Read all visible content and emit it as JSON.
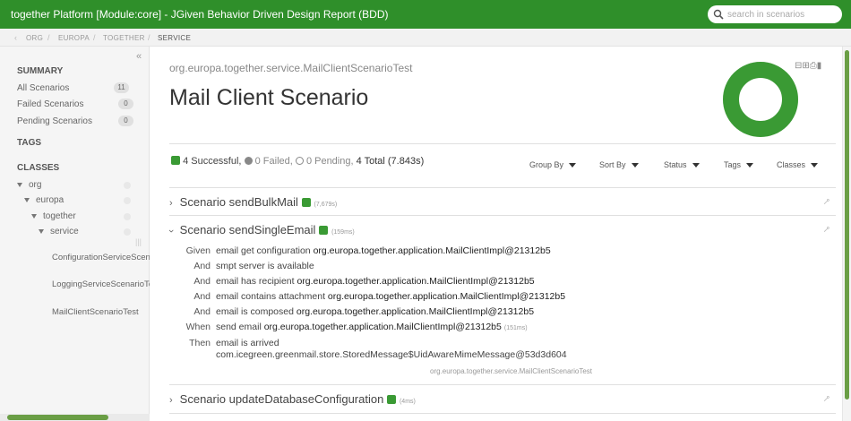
{
  "app": {
    "title": "together Platform [Module:core] - JGiven Behavior Driven Design Report (BDD)"
  },
  "search": {
    "placeholder": "search in scenarios"
  },
  "breadcrumb": [
    "ORG",
    "EUROPA",
    "TOGETHER",
    "SERVICE"
  ],
  "sidebar": {
    "summary_heading": "SUMMARY",
    "summary_items": [
      {
        "label": "All Scenarios",
        "count": "11"
      },
      {
        "label": "Failed Scenarios",
        "count": "0"
      },
      {
        "label": "Pending Scenarios",
        "count": "0"
      }
    ],
    "tags_heading": "TAGS",
    "classes_heading": "CLASSES",
    "tree": [
      "org",
      "europa",
      "together",
      "service"
    ],
    "classes": [
      "ConfigurationServiceScenarioTest",
      "LoggingServiceScenarioTest",
      "MailClientScenarioTest"
    ]
  },
  "main": {
    "class_name": "org.europa.together.service.MailClientScenarioTest",
    "title": "Mail Client Scenario",
    "summary": {
      "successful": "4 Successful,",
      "failed": "0 Failed,",
      "pending": "0 Pending,",
      "total": "4 Total (7.843s)"
    },
    "success_ratio": 1.0,
    "toolbar": [
      "Group By",
      "Sort By",
      "Status",
      "Tags",
      "Classes"
    ],
    "scenarios": [
      {
        "title": "Scenario sendBulkMail",
        "duration": "(7,679s)"
      },
      {
        "title": "Scenario sendSingleEmail",
        "duration": "(159ms)"
      },
      {
        "title": "Scenario updateDatabaseConfiguration",
        "duration": "(4ms)"
      }
    ],
    "steps": [
      {
        "keyword": "Given",
        "text": "email get configuration",
        "arg": "org.europa.together.application.MailClientImpl@21312b5",
        "duration": ""
      },
      {
        "keyword": "And",
        "text": "smpt server is available",
        "arg": "",
        "duration": ""
      },
      {
        "keyword": "And",
        "text": "email has recipient",
        "arg": "org.europa.together.application.MailClientImpl@21312b5",
        "duration": ""
      },
      {
        "keyword": "And",
        "text": "email contains attachment",
        "arg": "org.europa.together.application.MailClientImpl@21312b5",
        "duration": ""
      },
      {
        "keyword": "And",
        "text": "email is composed",
        "arg": "org.europa.together.application.MailClientImpl@21312b5",
        "duration": ""
      },
      {
        "keyword": "When",
        "text": "send email",
        "arg": "org.europa.together.application.MailClientImpl@21312b5",
        "duration": "(151ms)"
      },
      {
        "keyword": "Then",
        "text": "email is arrived",
        "arg": "com.icegreen.greenmail.store.StoredMessage$UidAwareMimeMessage@53d3d604",
        "duration": ""
      }
    ],
    "scenario_class": "org.europa.together.service.MailClientScenarioTest"
  },
  "colors": {
    "brand": "#2f8f2a",
    "success": "#3a9a34"
  },
  "icons": [
    "search-icon",
    "collapse-icon",
    "check-icon",
    "link-icon",
    "print-icon",
    "bookmark-icon",
    "chevron-right-icon",
    "chevron-down-icon"
  ]
}
